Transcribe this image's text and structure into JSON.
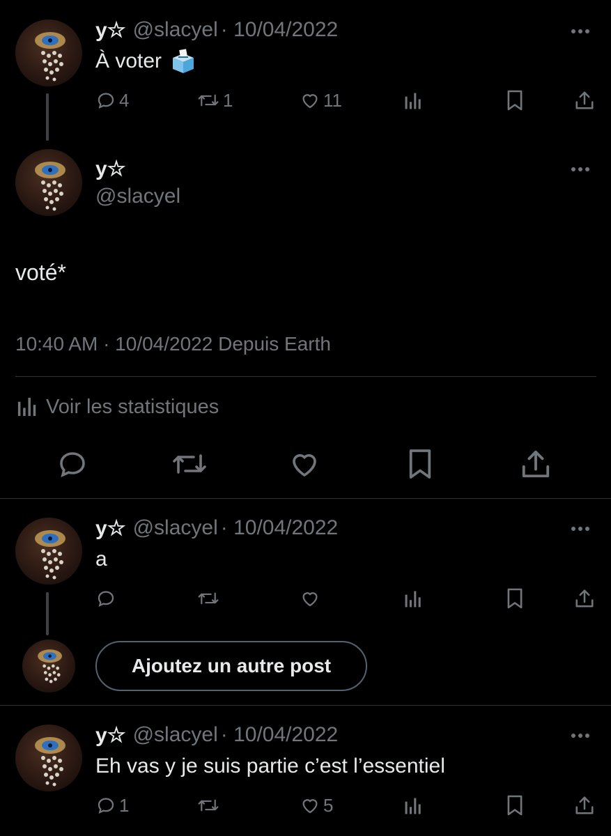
{
  "posts": [
    {
      "name": "y☆",
      "handle": "@slacyel",
      "date": "· 10/04/2022",
      "text": "À voter",
      "replies": "4",
      "reposts": "1",
      "likes": "11"
    },
    {
      "name": "y☆",
      "handle": "@slacyel",
      "text": "voté*",
      "timestamp": "10:40 AM · 10/04/2022 Depuis Earth",
      "stats_label": "Voir les statistiques"
    },
    {
      "name": "y☆",
      "handle": "@slacyel",
      "date": "· 10/04/2022",
      "text": "a",
      "replies": "",
      "reposts": "",
      "likes": ""
    },
    {
      "name": "y☆",
      "handle": "@slacyel",
      "date": "· 10/04/2022",
      "text": "Eh vas y je suis partie c’est l’essentiel",
      "replies": "1",
      "reposts": "",
      "likes": "5"
    }
  ],
  "compose": {
    "add_post_label": "Ajoutez un autre post"
  },
  "icons": {
    "reply": "speech-bubble-icon",
    "repost": "repost-arrows-icon",
    "like": "heart-icon",
    "views": "bar-chart-icon",
    "bookmark": "bookmark-icon",
    "share": "share-upload-icon",
    "more": "ellipsis-icon",
    "ballot": "ballot-box-emoji"
  },
  "colors": {
    "background": "#000000",
    "text": "#e7e9ea",
    "muted": "#71767b",
    "divider": "#2f3336",
    "thread_line": "#3d4247"
  }
}
